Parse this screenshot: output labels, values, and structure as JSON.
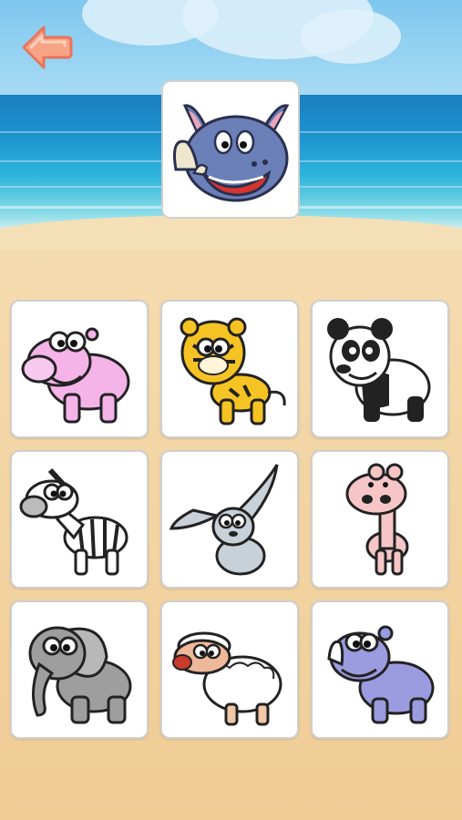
{
  "screen": "animal-matching",
  "back_button": {
    "icon": "back-arrow-icon",
    "color": "#f28a68"
  },
  "target": {
    "animal": "rhino",
    "icon": "rhino-face-icon"
  },
  "choices": [
    {
      "animal": "hippo",
      "icon": "hippo-icon"
    },
    {
      "animal": "tiger",
      "icon": "tiger-icon"
    },
    {
      "animal": "panda",
      "icon": "panda-icon"
    },
    {
      "animal": "zebra",
      "icon": "zebra-icon"
    },
    {
      "animal": "rabbit",
      "icon": "rabbit-icon"
    },
    {
      "animal": "giraffe",
      "icon": "giraffe-icon"
    },
    {
      "animal": "elephant",
      "icon": "elephant-icon"
    },
    {
      "animal": "sheep",
      "icon": "sheep-icon"
    },
    {
      "animal": "rhino",
      "icon": "rhino-icon"
    }
  ],
  "colors": {
    "sea": "#1d93cf",
    "sand": "#f4d9ab",
    "card_border": "#cfcfcf"
  }
}
